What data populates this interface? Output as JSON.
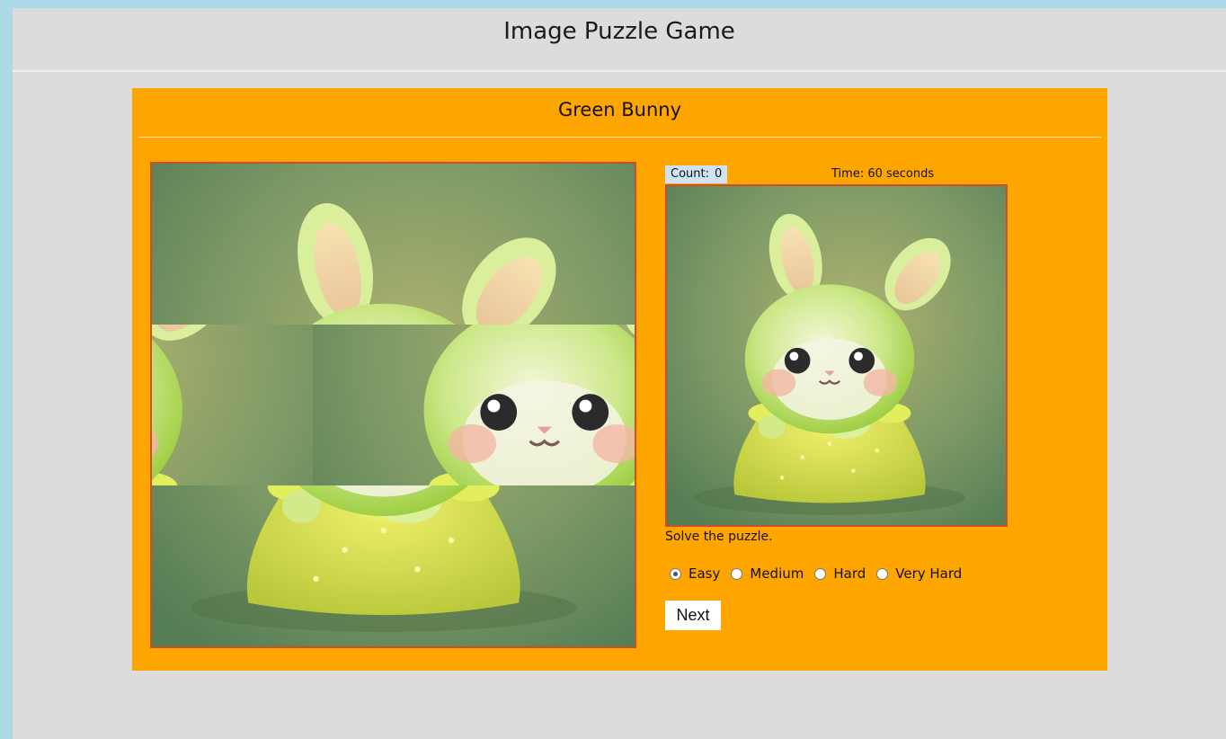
{
  "app": {
    "title": "Image Puzzle Game"
  },
  "puzzle": {
    "name": "Green Bunny",
    "grid_size": 3,
    "tiles": [
      {
        "piece": 1
      },
      {
        "piece": 2
      },
      {
        "piece": 3
      },
      {
        "piece": 6
      },
      {
        "piece": 4
      },
      {
        "piece": 5
      },
      {
        "piece": 7
      },
      {
        "piece": 8
      },
      {
        "piece": 9
      }
    ]
  },
  "status": {
    "count_label": "Count:",
    "count_value": "0",
    "time_text": "Time: 60 seconds"
  },
  "instruction": "Solve the puzzle.",
  "difficulty": {
    "options": [
      {
        "label": "Easy",
        "selected": true
      },
      {
        "label": "Medium",
        "selected": false
      },
      {
        "label": "Hard",
        "selected": false
      },
      {
        "label": "Very Hard",
        "selected": false
      }
    ]
  },
  "controls": {
    "next_label": "Next"
  },
  "colors": {
    "page_background": "#add8e6",
    "content_background": "#dcdcdc",
    "panel": "#ffa500",
    "count_background": "#cfe3f5",
    "frame_border": "#c8502a"
  }
}
